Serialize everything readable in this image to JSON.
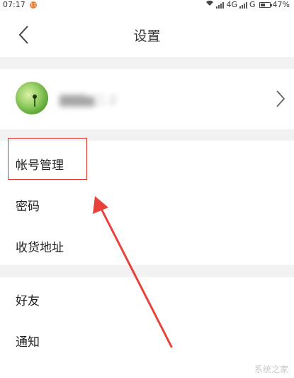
{
  "status_bar": {
    "time": "07:17",
    "notification_badge": "11",
    "network_1": "4G",
    "network_2": "G",
    "battery": "47%",
    "battery_level": 0.47
  },
  "header": {
    "back_icon": "chevron-left-icon",
    "title": "设置"
  },
  "profile": {
    "username": "▇▇▇▆二 2",
    "chevron_icon": "chevron-right-icon"
  },
  "menu_group_1": {
    "items": [
      {
        "label": "帐号管理"
      },
      {
        "label": "密码"
      },
      {
        "label": "收货地址"
      }
    ]
  },
  "menu_group_2": {
    "items": [
      {
        "label": "好友"
      },
      {
        "label": "通知"
      }
    ]
  },
  "annotation": {
    "highlight_color": "#e0312b"
  },
  "watermark": "系统之家"
}
